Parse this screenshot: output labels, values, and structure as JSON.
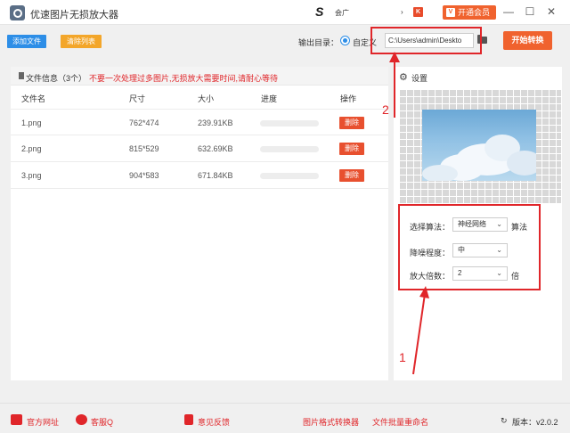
{
  "title_bar": {
    "app_title": "优速图片无损放大器",
    "tray_logo": "S",
    "tray_text": "会广",
    "tray_arrow": "›",
    "k_badge": "K",
    "vip_label": "开通会员",
    "minimize": "—",
    "restore": "☐",
    "close": "✕"
  },
  "toolbar": {
    "add_file": "添加文件",
    "clear_list": "清除列表",
    "output_label": "输出目录：",
    "custom_label": "自定义",
    "output_path": "C:\\Users\\admin\\Deskto",
    "start_button": "开始转换"
  },
  "annotations": {
    "num1": "1",
    "num2": "2"
  },
  "file_panel": {
    "info_label": "文件信息（3个）",
    "warning": "不要一次处理过多图片,无损放大需要时间,请耐心等待",
    "columns": [
      "文件名",
      "尺寸",
      "大小",
      "进度",
      "操作"
    ],
    "rows": [
      {
        "name": "1.png",
        "dims": "762*474",
        "size": "239.91KB",
        "progress": 0,
        "action": "删除"
      },
      {
        "name": "2.png",
        "dims": "815*529",
        "size": "632.69KB",
        "progress": 0,
        "action": "删除"
      },
      {
        "name": "3.png",
        "dims": "904*583",
        "size": "671.84KB",
        "progress": 0,
        "action": "删除"
      }
    ]
  },
  "settings": {
    "title": "设置",
    "algorithm_label": "选择算法：",
    "algorithm_value": "神经网络",
    "algorithm_suffix": "算法",
    "noise_label": "降噪程度：",
    "noise_value": "中",
    "scale_label": "放大倍数：",
    "scale_value": "2",
    "scale_suffix": "倍"
  },
  "footer": {
    "website": "官方网址",
    "support": "客服Q",
    "feedback": "意见反馈",
    "format_converter": "图片格式转换器",
    "batch_rename": "文件批量重命名",
    "version": "版本：v2.0.2"
  },
  "colors": {
    "accent_blue": "#2d8ee7",
    "accent_orange": "#f0622e",
    "clear_yellow": "#f3a62a",
    "annotation_red": "#e0262a"
  }
}
